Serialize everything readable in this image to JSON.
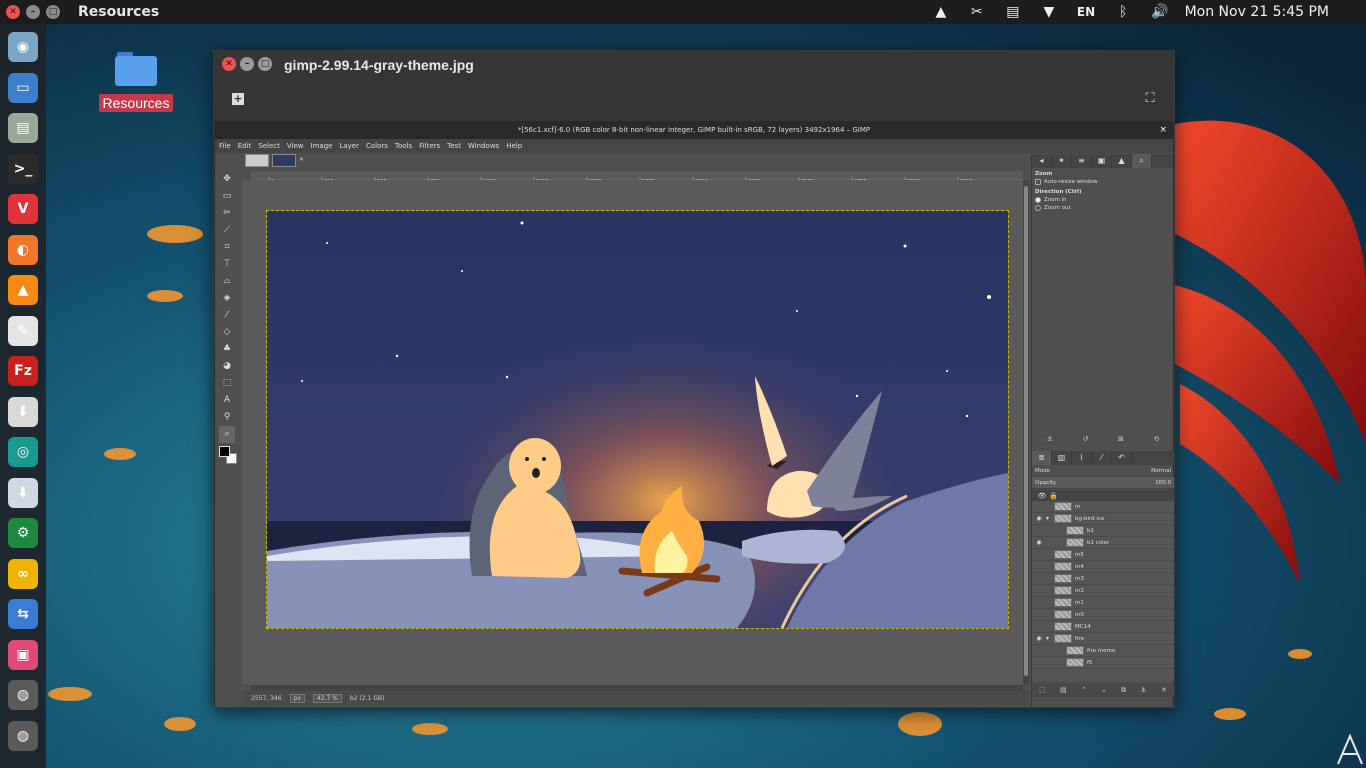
{
  "topbar": {
    "app_name": "Resources",
    "clock": "Mon Nov 21  5:45 PM",
    "tray": [
      {
        "icon": "vlc-cone-icon",
        "glyph": "▲"
      },
      {
        "icon": "scissors-icon",
        "glyph": "✂"
      },
      {
        "icon": "notes-icon",
        "glyph": "▤"
      },
      {
        "icon": "wifi-icon",
        "glyph": "▼"
      },
      {
        "icon": "keyboard-layout",
        "glyph": "EN"
      },
      {
        "icon": "bluetooth-icon",
        "glyph": "ᛒ"
      },
      {
        "icon": "volume-icon",
        "glyph": "🔊"
      }
    ]
  },
  "dock": [
    {
      "icon": "chromium-like-icon",
      "glyph": "◉",
      "color": "#7aa6c7"
    },
    {
      "icon": "monitor-icon",
      "glyph": "▭",
      "color": "#3d7fcc"
    },
    {
      "icon": "drive-icon",
      "glyph": "▤",
      "color": "#9aa89a"
    },
    {
      "icon": "terminal-icon",
      "glyph": ">_",
      "color": "#2b2b2b"
    },
    {
      "icon": "vivaldi-icon",
      "glyph": "V",
      "color": "#e2333d"
    },
    {
      "icon": "firefox-icon",
      "glyph": "◐",
      "color": "#f1762a"
    },
    {
      "icon": "vlc-icon",
      "glyph": "▲",
      "color": "#f48a12"
    },
    {
      "icon": "text-editor-icon",
      "glyph": "✎",
      "color": "#e5e5e5"
    },
    {
      "icon": "filezilla-icon",
      "glyph": "Fz",
      "color": "#c8201f"
    },
    {
      "icon": "download-icon",
      "glyph": "⬇",
      "color": "#d9d9d9"
    },
    {
      "icon": "shutter-icon",
      "glyph": "◎",
      "color": "#1a9a8f"
    },
    {
      "icon": "package-icon",
      "glyph": "⬇",
      "color": "#cfd8e3"
    },
    {
      "icon": "settings-tool-icon",
      "glyph": "⚙",
      "color": "#1f8a3e"
    },
    {
      "icon": "sync-icon",
      "glyph": "∞",
      "color": "#f0b400"
    },
    {
      "icon": "toggles-icon",
      "glyph": "⇆",
      "color": "#3a7bd5"
    },
    {
      "icon": "photo-app-icon",
      "glyph": "▣",
      "color": "#e14a77"
    },
    {
      "icon": "disk-icon",
      "glyph": "◍",
      "color": "#5a5a5a"
    },
    {
      "icon": "disk2-icon",
      "glyph": "◍",
      "color": "#5a5a5a"
    }
  ],
  "desktop": {
    "folder_label": "Resources"
  },
  "viewer": {
    "title": "gimp-2.99.14-gray-theme.jpg"
  },
  "gimp": {
    "title": "*[56c1.xcf]-6.0 (RGB color 8-bit non-linear integer, GIMP built-in sRGB, 72 layers) 3492x1964 – GIMP",
    "menu": [
      "File",
      "Edit",
      "Select",
      "View",
      "Image",
      "Layer",
      "Colors",
      "Tools",
      "Filters",
      "Test",
      "Windows",
      "Help"
    ],
    "ruler_labels": [
      "0",
      "250",
      "500",
      "750",
      "1000",
      "1250",
      "1500",
      "1750",
      "2000",
      "2250",
      "2500",
      "2750",
      "3000",
      "3250"
    ],
    "status": {
      "coords": "2557, 346",
      "unit": "px",
      "zoom": "42.7 %",
      "info": "b2 (2.1 GB)"
    },
    "tool_options": {
      "title": "Zoom",
      "auto_resize": "Auto-resize window",
      "direction": "Direction  (Ctrl)",
      "zoom_in": "Zoom in",
      "zoom_out": "Zoom out"
    },
    "layers": {
      "mode_label": "Mode",
      "mode_value": "Normal",
      "opacity_label": "Opacity",
      "opacity_value": "100.0",
      "items": [
        {
          "name": "m",
          "visible": false,
          "group": false,
          "indent": 0
        },
        {
          "name": "bg-bird ice",
          "visible": true,
          "group": true,
          "indent": 0
        },
        {
          "name": "b1",
          "visible": false,
          "group": false,
          "indent": 1
        },
        {
          "name": "b1 color",
          "visible": true,
          "group": false,
          "indent": 1
        },
        {
          "name": "m5",
          "visible": false,
          "group": false,
          "indent": 0
        },
        {
          "name": "m4",
          "visible": false,
          "group": false,
          "indent": 0
        },
        {
          "name": "m3",
          "visible": false,
          "group": false,
          "indent": 0
        },
        {
          "name": "m2",
          "visible": false,
          "group": false,
          "indent": 0
        },
        {
          "name": "m1",
          "visible": false,
          "group": false,
          "indent": 0
        },
        {
          "name": "m0",
          "visible": false,
          "group": false,
          "indent": 0
        },
        {
          "name": "MC14",
          "visible": false,
          "group": false,
          "indent": 0
        },
        {
          "name": "fire",
          "visible": true,
          "group": true,
          "indent": 0
        },
        {
          "name": "fire memo",
          "visible": false,
          "group": false,
          "indent": 1
        },
        {
          "name": "f5",
          "visible": false,
          "group": false,
          "indent": 1
        }
      ]
    }
  }
}
